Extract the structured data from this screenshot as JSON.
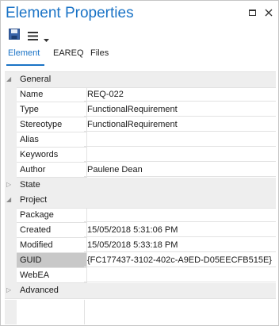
{
  "window": {
    "title": "Element Properties"
  },
  "titlebar_buttons": [
    {
      "icon": "maximize-icon"
    },
    {
      "icon": "close-icon"
    }
  ],
  "toolbar": [
    {
      "icon": "save-icon"
    },
    {
      "icon": "menu-icon"
    },
    {
      "icon": "chevron-down-icon"
    }
  ],
  "tabs": [
    {
      "label": "Element",
      "active": true
    },
    {
      "label": "EAREQ"
    },
    {
      "label": "Files"
    }
  ],
  "categories": {
    "general": {
      "label": "General",
      "expanded": true
    },
    "state": {
      "label": "State",
      "expanded": false
    },
    "project": {
      "label": "Project",
      "expanded": true
    },
    "advanced": {
      "label": "Advanced",
      "expanded": false
    }
  },
  "general_rows": [
    {
      "name": "Name",
      "value": "REQ-022"
    },
    {
      "name": "Type",
      "value": "FunctionalRequirement"
    },
    {
      "name": "Stereotype",
      "value": "FunctionalRequirement"
    },
    {
      "name": "Alias",
      "value": ""
    },
    {
      "name": "Keywords",
      "value": ""
    },
    {
      "name": "Author",
      "value": "Paulene Dean"
    }
  ],
  "project_rows": [
    {
      "name": "Package",
      "value": ""
    },
    {
      "name": "Created",
      "value": "15/05/2018 5:31:06 PM"
    },
    {
      "name": "Modified",
      "value": "15/05/2018 5:33:18 PM"
    },
    {
      "name": "GUID",
      "value": "{FC177437-3102-402c-A9ED-D05EECFB515E}",
      "selected": true
    },
    {
      "name": "WebEA",
      "value": ""
    }
  ],
  "colors": {
    "accent": "#1a73c6",
    "selected_cell": "#c8c8c8",
    "category_bg": "#eeeeee"
  }
}
